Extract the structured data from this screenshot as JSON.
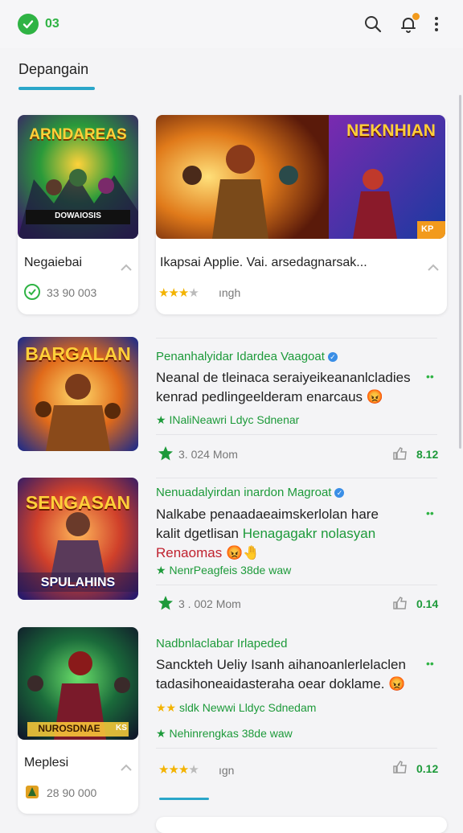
{
  "header": {
    "badge_text": "03",
    "icons": [
      "check-icon",
      "search-icon",
      "bell-icon",
      "more-vert-icon"
    ]
  },
  "tab": {
    "label": "Depangain"
  },
  "featured": [
    {
      "thumb_text": "ARNDAREAS",
      "thumb_sub": "DOWAIOSIS",
      "title": "Negaiebai",
      "meta": "33 90 003"
    },
    {
      "thumb_text": "NEKNHIAN",
      "thumb_badge": "KP",
      "title": "Ikapsai Applie. Vai. arsedagnarsak...",
      "meta": "ıngh",
      "rating": 3
    }
  ],
  "items": [
    {
      "thumb_text": "BARGALAN",
      "title": "Penanhalyidar Idardea Vaagoat",
      "desc_line1": "Neanal de tleinaca seraiyeikeananlcladies",
      "desc_line2": "kenrad pedlingeelderam enarcaus",
      "desc_line3": "",
      "desc_line3_green": "",
      "desc_emoji": "😡",
      "link": "INaliNeawri Ldyc Sdnenar",
      "count": "3. 024 Mom",
      "score": "8.12"
    },
    {
      "thumb_text": "SENGASAN",
      "thumb_sub": "SPULAHINS",
      "title": "Nenuadalyirdan inardon Magroat",
      "desc_line1": "Nalkabe penaadaeaimskerlolan hare",
      "desc_line2": "kalit dgetlisan",
      "desc_line2_green": "Henagagakr nolasyan",
      "desc_line3": "Renaomas",
      "desc_emoji": "😡🤚",
      "link": "NenrPeagfeis 38de waw",
      "count": "3 . 002 Mom",
      "score": "0.14"
    },
    {
      "thumb_text": "NUROSDNAE",
      "thumb_badge": "KS",
      "title": "Nadbnlaclabar Irlapeded",
      "desc_line1": "Sanckteh Ueliy Isanh aihanoanlerlelaclen",
      "desc_line2": "tadasihoneaidasteraha oear doklame.",
      "desc_emoji": "😡",
      "link": "sldk Newwi Lldyc Sdnedam",
      "link2": "Nehinrengkas 38de waw",
      "count": "ıgn",
      "score": "0.12",
      "side_title": "Meplesi",
      "side_meta": "28 90 000"
    }
  ]
}
